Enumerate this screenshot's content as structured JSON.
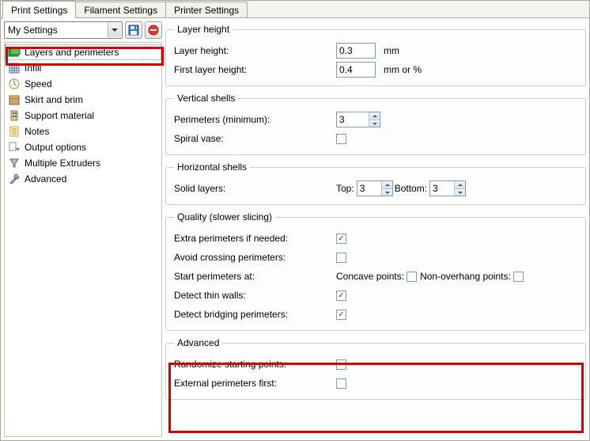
{
  "tabs": [
    "Print Settings",
    "Filament Settings",
    "Printer Settings"
  ],
  "activeTab": 0,
  "preset": {
    "label": "My Settings"
  },
  "sidebar": {
    "items": [
      "Layers and perimeters",
      "Infill",
      "Speed",
      "Skirt and brim",
      "Support material",
      "Notes",
      "Output options",
      "Multiple Extruders",
      "Advanced"
    ],
    "selectedIndex": 0
  },
  "layer_height": {
    "legend": "Layer height",
    "height_label": "Layer height:",
    "height_value": "0.3",
    "height_unit": "mm",
    "first_label": "First layer height:",
    "first_value": "0.4",
    "first_unit": "mm or %"
  },
  "vertical_shells": {
    "legend": "Vertical shells",
    "perimeters_label": "Perimeters (minimum):",
    "perimeters_value": "3",
    "spiral_vase_label": "Spiral vase:",
    "spiral_vase_checked": false
  },
  "horizontal_shells": {
    "legend": "Horizontal shells",
    "solid_layers_label": "Solid layers:",
    "top_label": "Top:",
    "top_value": "3",
    "bottom_label": "Bottom:",
    "bottom_value": "3"
  },
  "quality": {
    "legend": "Quality (slower slicing)",
    "extra_perimeters_label": "Extra perimeters if needed:",
    "extra_perimeters_checked": true,
    "avoid_crossing_label": "Avoid crossing perimeters:",
    "avoid_crossing_checked": false,
    "start_perimeters_label": "Start perimeters at:",
    "concave_label": "Concave points:",
    "concave_checked": false,
    "nonoverhang_label": "Non-overhang points:",
    "nonoverhang_checked": false,
    "thin_walls_label": "Detect thin walls:",
    "thin_walls_checked": true,
    "bridging_label": "Detect bridging perimeters:",
    "bridging_checked": true
  },
  "advanced": {
    "legend": "Advanced",
    "randomize_label": "Randomize starting points:",
    "randomize_checked": false,
    "external_first_label": "External perimeters first:",
    "external_first_checked": false
  }
}
